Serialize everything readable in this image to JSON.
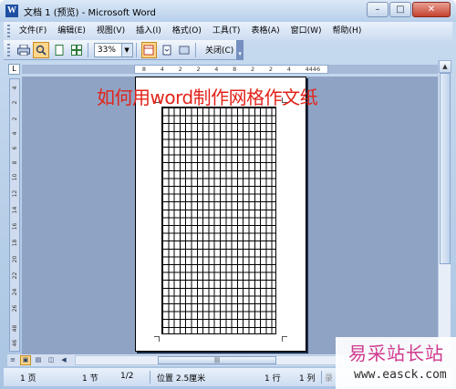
{
  "window": {
    "title": "文档 1 (预览) - Microsoft Word",
    "app_icon": "W",
    "minimize": "–",
    "maximize": "□",
    "close": "✕"
  },
  "menu": [
    "文件(F)",
    "编辑(E)",
    "视图(V)",
    "插入(I)",
    "格式(O)",
    "工具(T)",
    "表格(A)",
    "窗口(W)",
    "帮助(H)"
  ],
  "toolbar": {
    "zoom": "33%",
    "close_label": "关闭(C)"
  },
  "ruler": {
    "corner": "L",
    "h_labels": [
      "8",
      "4",
      "2",
      "2",
      "4",
      "8",
      "2",
      "2",
      "4",
      "4446"
    ],
    "v_labels": [
      "4",
      "2",
      "2",
      "4",
      "6",
      "8",
      "10",
      "12",
      "14",
      "16",
      "18",
      "20",
      "22",
      "24",
      "26",
      "48",
      "46"
    ]
  },
  "overlay_title": "如何用word制作网格作文纸",
  "status": {
    "page": "1 页",
    "section": "1 节",
    "page_of": "1/2",
    "position": "位置 2.5厘米",
    "line": "1 行",
    "column": "1 列",
    "rec": "录"
  },
  "watermark": {
    "cn": "易采站长站",
    "url": "www.easck.com"
  },
  "colors": {
    "title_red": "#e2231a",
    "workspace": "#8fa3c4",
    "watermark_pink": "#d03a8e"
  }
}
